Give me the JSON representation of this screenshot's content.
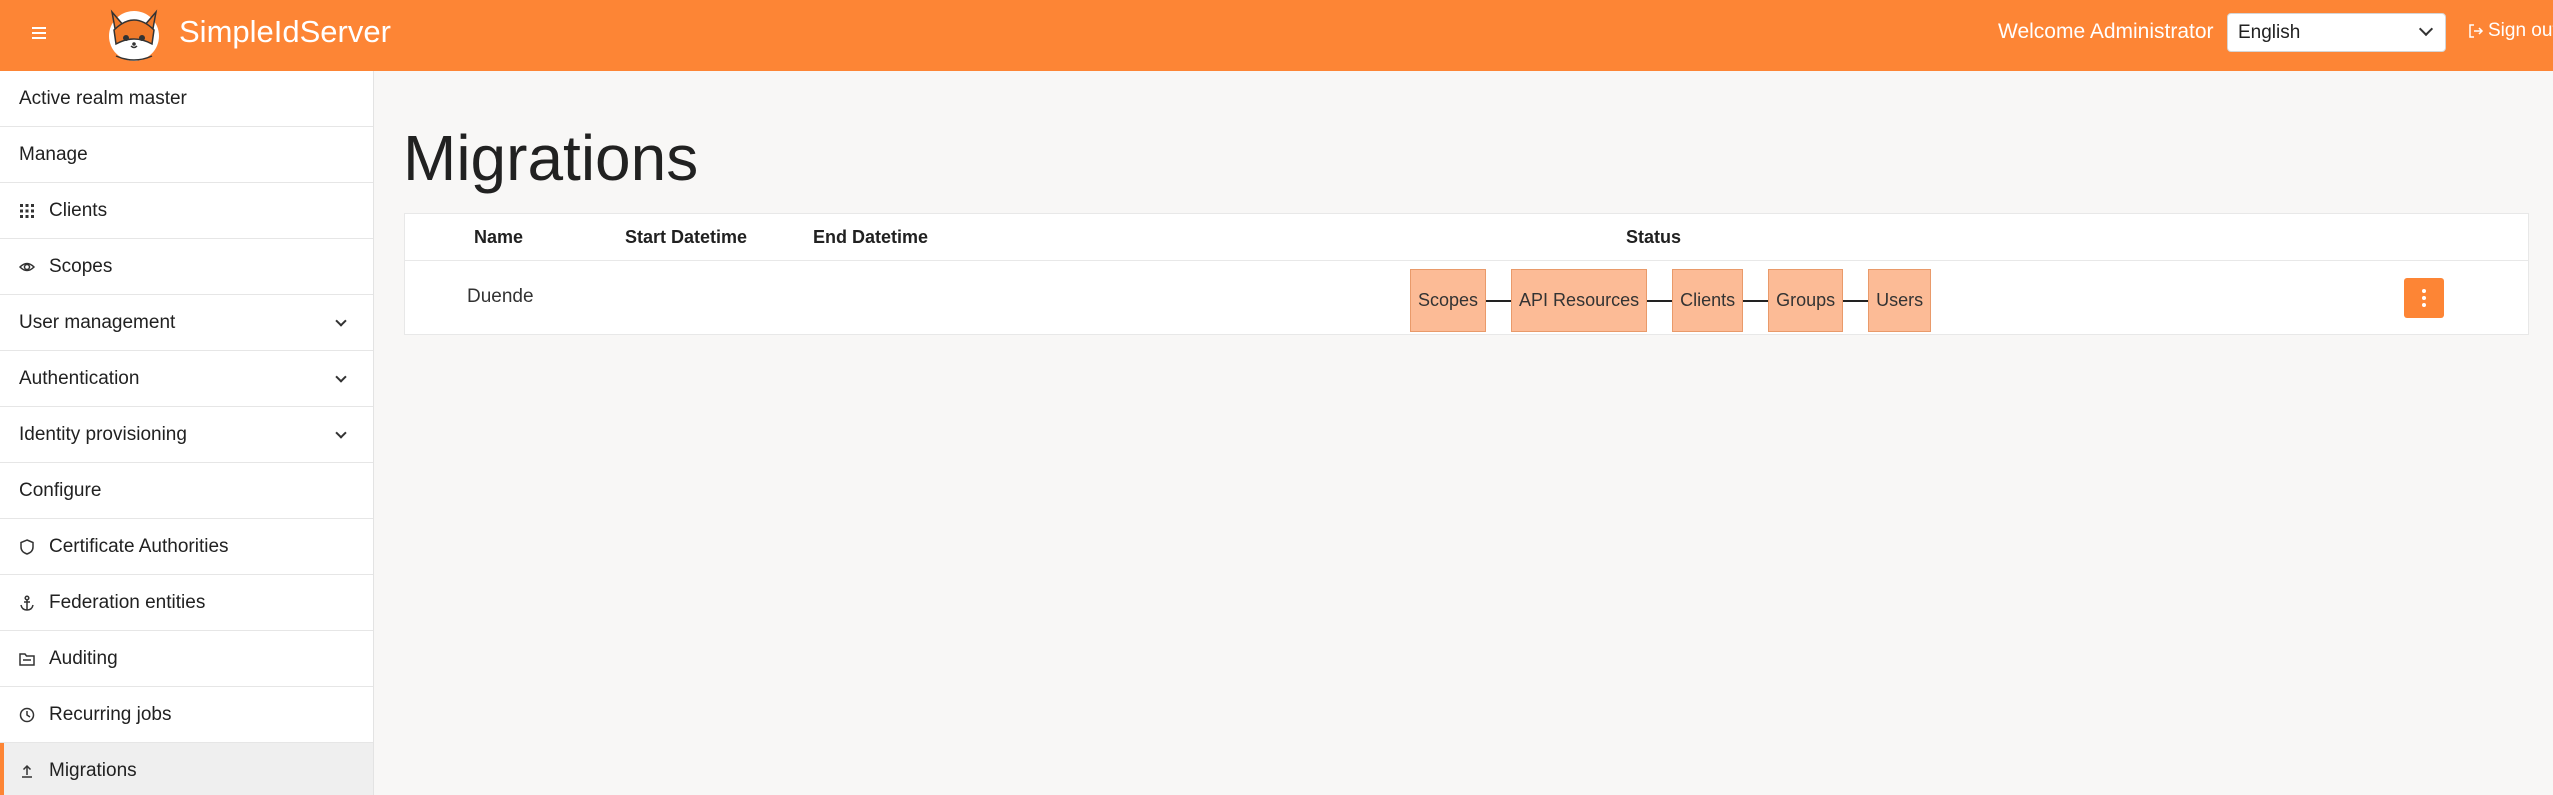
{
  "header": {
    "brand": "SimpleIdServer",
    "welcome": "Welcome Administrator",
    "language": "English",
    "signout": "Sign out",
    "accent": "#fd8535"
  },
  "sidebar": {
    "items": [
      {
        "label": "Active realm master",
        "type": "section"
      },
      {
        "label": "Manage",
        "type": "section"
      },
      {
        "label": "Clients",
        "icon": "grid-icon"
      },
      {
        "label": "Scopes",
        "icon": "eye-icon"
      },
      {
        "label": "User management",
        "type": "group"
      },
      {
        "label": "Authentication",
        "type": "group"
      },
      {
        "label": "Identity provisioning",
        "type": "group"
      },
      {
        "label": "Configure",
        "type": "section"
      },
      {
        "label": "Certificate Authorities",
        "icon": "shield-icon"
      },
      {
        "label": "Federation entities",
        "icon": "anchor-icon"
      },
      {
        "label": "Auditing",
        "icon": "folder-icon"
      },
      {
        "label": "Recurring jobs",
        "icon": "clock-icon"
      },
      {
        "label": "Migrations",
        "icon": "upload-icon",
        "active": true
      }
    ]
  },
  "main": {
    "title": "Migrations",
    "table": {
      "headers": {
        "name": "Name",
        "start": "Start Datetime",
        "end": "End Datetime",
        "status": "Status"
      },
      "rows": [
        {
          "name": "Duende",
          "start": "",
          "end": "",
          "steps": [
            "Scopes",
            "API Resources",
            "Clients",
            "Groups",
            "Users"
          ]
        }
      ]
    }
  }
}
